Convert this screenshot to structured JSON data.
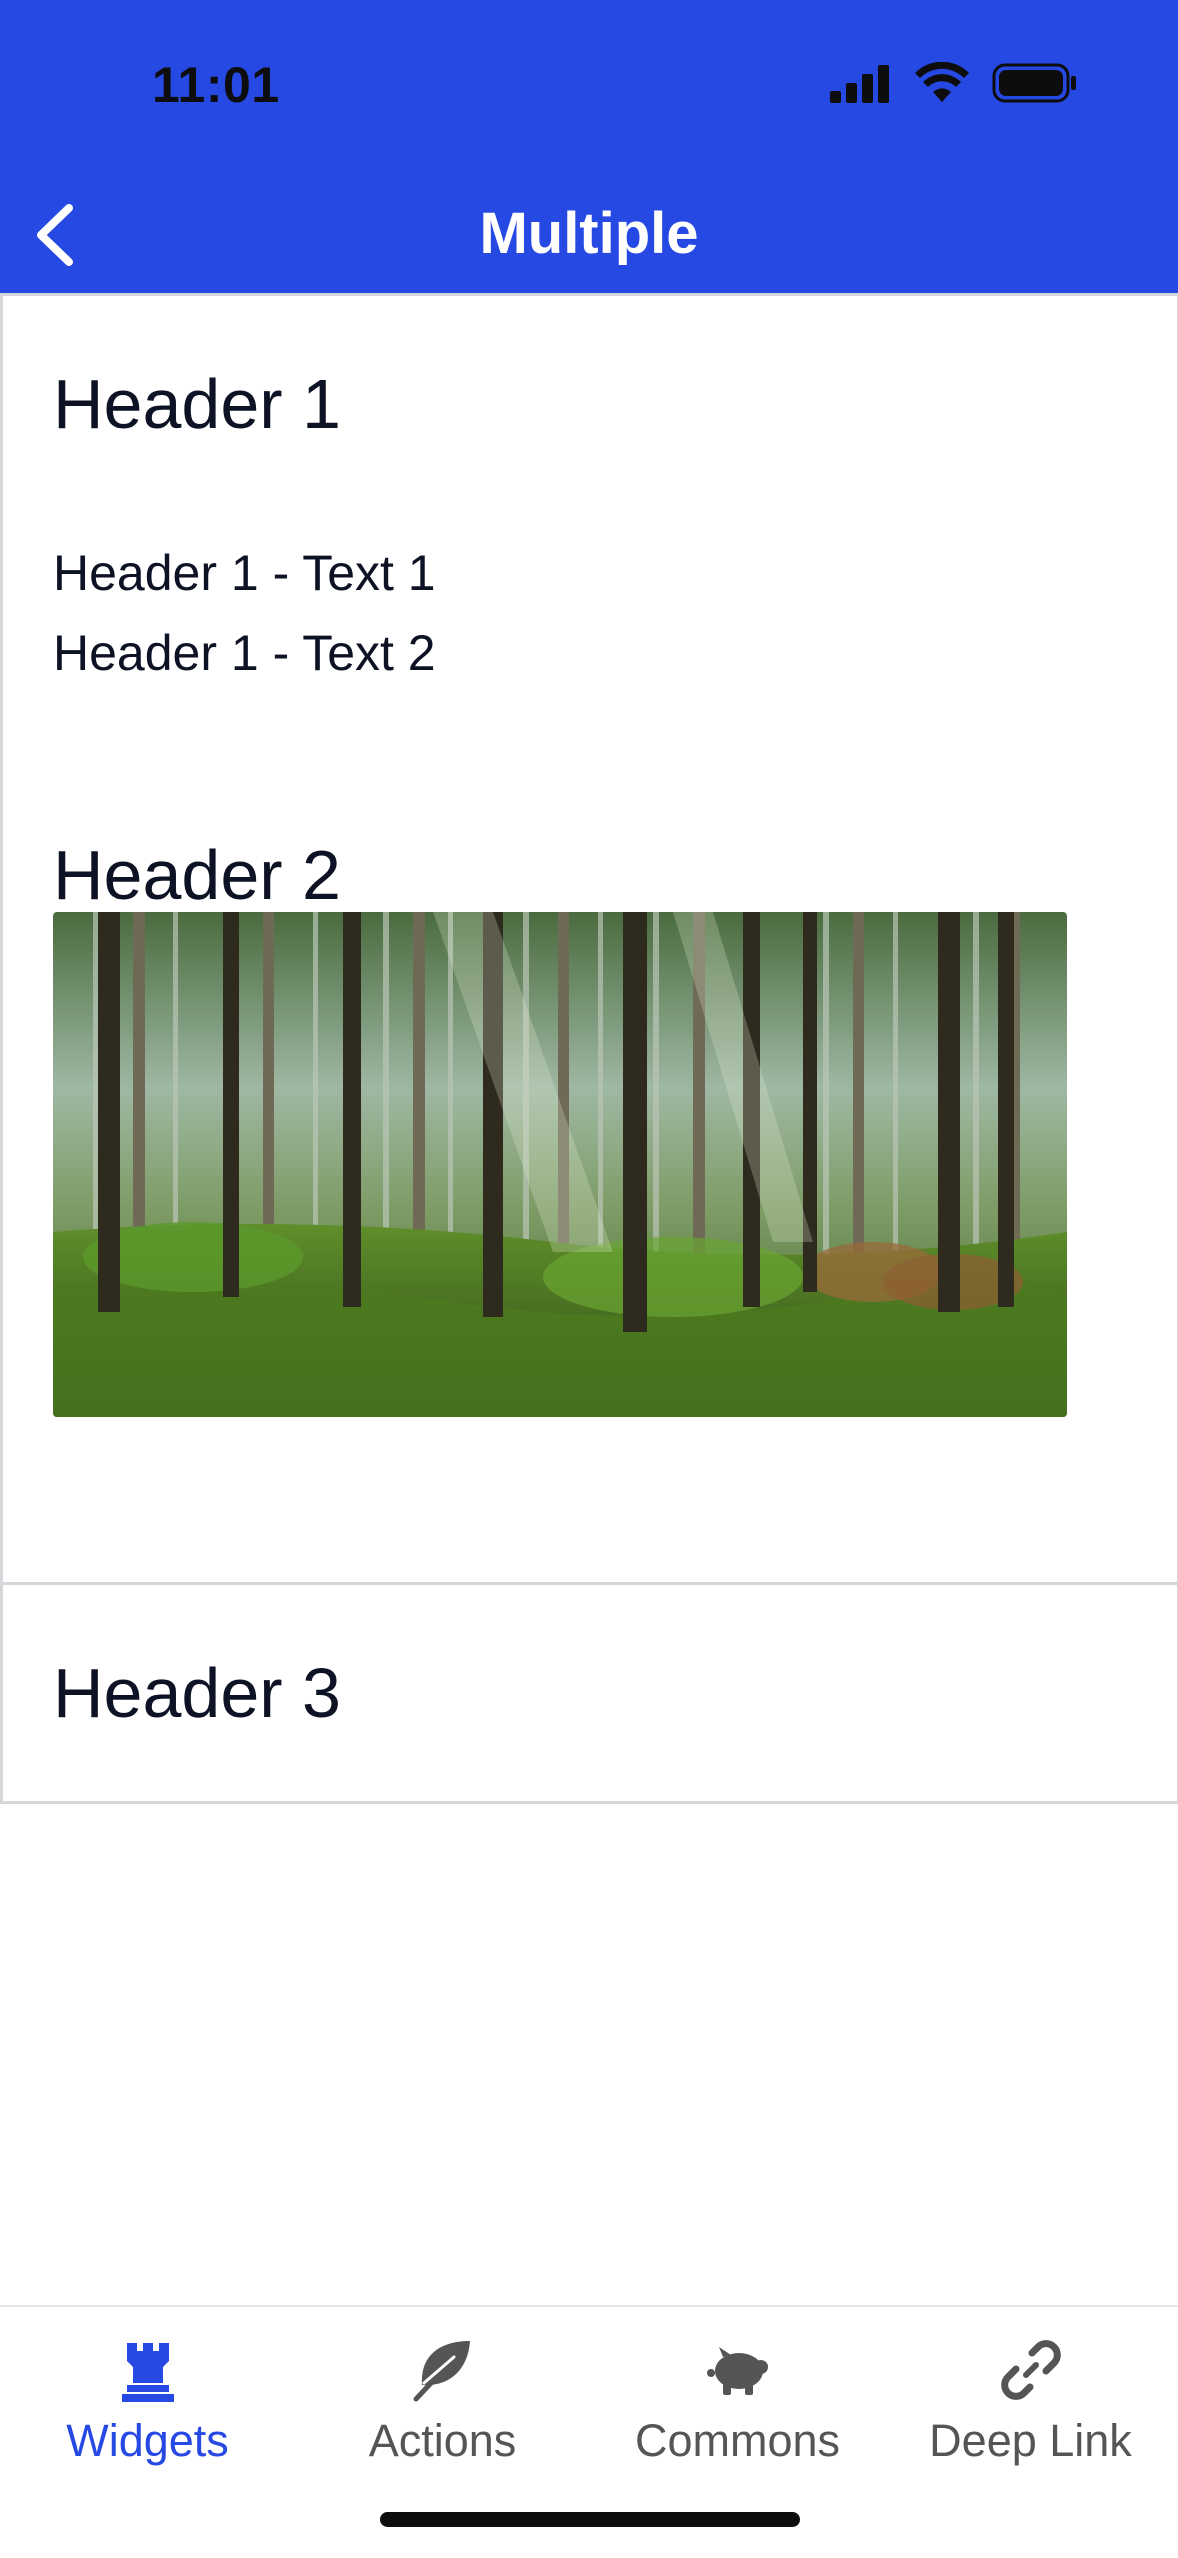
{
  "status_bar": {
    "time": "11:01"
  },
  "nav": {
    "title": "Multiple",
    "back_icon": "chevron-left-icon"
  },
  "sections": [
    {
      "header": "Header 1",
      "texts": [
        "Header 1 - Text 1",
        "Header 1 - Text 2"
      ]
    },
    {
      "header": "Header 2",
      "image": "forest-photo"
    },
    {
      "header": "Header 3"
    }
  ],
  "tabs": [
    {
      "label": "Widgets",
      "icon": "rook-icon",
      "active": true
    },
    {
      "label": "Actions",
      "icon": "leaf-icon",
      "active": false
    },
    {
      "label": "Commons",
      "icon": "piggy-bank-icon",
      "active": false
    },
    {
      "label": "Deep Link",
      "icon": "link-icon",
      "active": false
    }
  ],
  "colors": {
    "accent": "#2648e3",
    "text": "#0d1224",
    "tab_inactive": "#555555",
    "divider": "#d4d6da"
  }
}
